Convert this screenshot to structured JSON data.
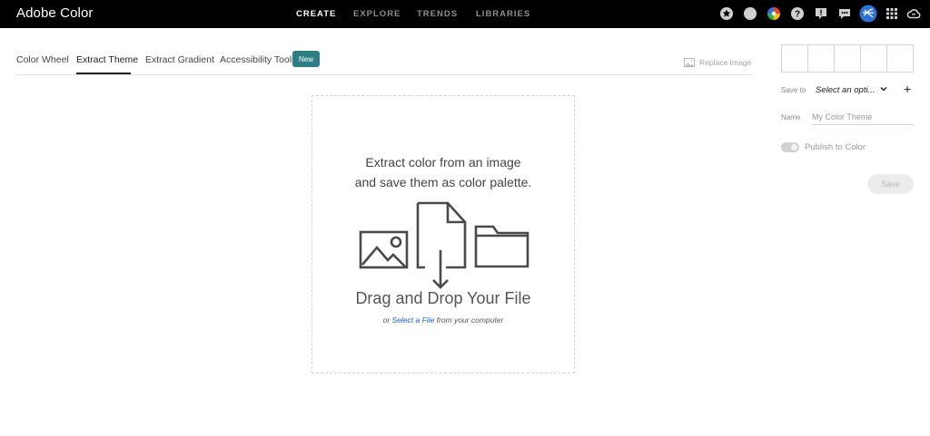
{
  "app": {
    "brand": "Adobe Color"
  },
  "topnav": [
    {
      "label": "CREATE",
      "active": true
    },
    {
      "label": "EXPLORE",
      "active": false
    },
    {
      "label": "TRENDS",
      "active": false
    },
    {
      "label": "LIBRARIES",
      "active": false
    }
  ],
  "top_icons": [
    "star-icon",
    "moon-icon",
    "color-wheel-icon",
    "help-icon",
    "feedback-icon",
    "chat-icon",
    "avatar",
    "apps-grid-icon",
    "creative-cloud-icon"
  ],
  "tabs": [
    {
      "label": "Color Wheel",
      "active": false
    },
    {
      "label": "Extract Theme",
      "active": true
    },
    {
      "label": "Extract Gradient",
      "active": false
    },
    {
      "label": "Accessibility Tools",
      "active": false
    }
  ],
  "new_badge": "New",
  "replace_image": "Replace Image",
  "dropzone": {
    "line1": "Extract color from an image",
    "line2": "and save them as color palette.",
    "drag": "Drag and Drop Your File",
    "sub_prefix": "or ",
    "sub_link": "Select a File",
    "sub_suffix": " from your computer"
  },
  "panel": {
    "swatch_count": 5,
    "save_to_label": "Save to",
    "save_to_value": "Select an opti...",
    "add_symbol": "+",
    "name_label": "Name",
    "name_placeholder": "My Color Theme",
    "publish_label": "Publish to Color",
    "save_label": "Save"
  },
  "colors": {
    "accent": "#2d7f85",
    "link": "#1c5ad9",
    "topbar": "#000000"
  }
}
